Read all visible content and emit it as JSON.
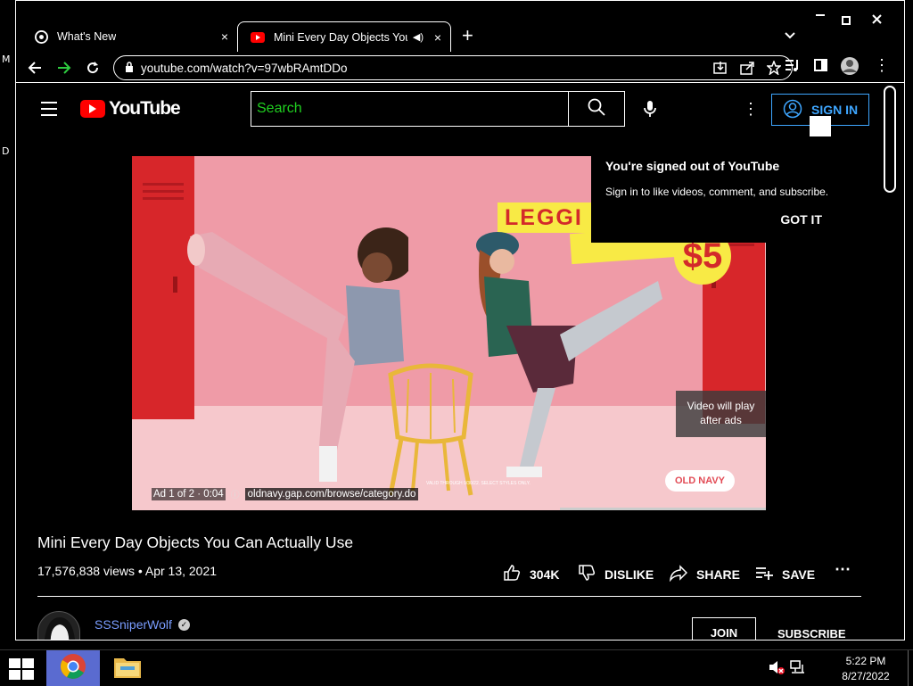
{
  "desktop": {
    "edge_text_1": "M",
    "edge_text_2": "D"
  },
  "browser": {
    "tabs": [
      {
        "title": "What's New",
        "favicon": "chrome-icon",
        "active": false,
        "close": "×"
      },
      {
        "title": "Mini Every Day Objects You Ca",
        "favicon": "youtube-favicon",
        "active": true,
        "close": "×"
      }
    ],
    "new_tab": "+",
    "url": "youtube.com/watch?v=97wbRAmtDDo"
  },
  "youtube": {
    "logo_text": "YouTube",
    "search_placeholder": "Search",
    "signin_label": "SIGN IN",
    "popup": {
      "heading": "You're signed out of YouTube",
      "body": "Sign in to like videos, comment, and subscribe.",
      "button": "GOT IT"
    },
    "video": {
      "ad_label": "Ad 1 of 2 · 0:04",
      "ad_url": "oldnavy.gap.com/browse/category.do",
      "play_note_line1": "Video will play",
      "play_note_line2": "after ads",
      "sign_text": "LEGGI",
      "price_text": "$5",
      "brand_badge": "OLD NAVY",
      "fine_print": "VALID THROUGH 9/30/22. SELECT STYLES ONLY."
    },
    "title": "Mini Every Day Objects You Can Actually Use",
    "meta": "17,576,838 views • Apr 13, 2021",
    "actions": {
      "likes": "304K",
      "dislike": "DISLIKE",
      "share": "SHARE",
      "save": "SAVE"
    },
    "channel": {
      "name": "SSSniperWolf"
    },
    "join_label": "JOIN",
    "subscribe_label": "SUBSCRIBE"
  },
  "taskbar": {
    "time": "5:22 PM",
    "date": "8/27/2022"
  }
}
